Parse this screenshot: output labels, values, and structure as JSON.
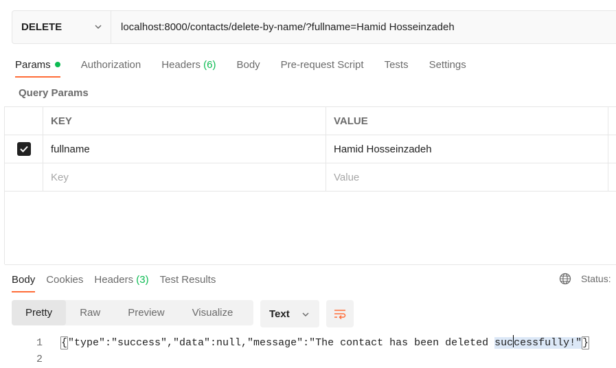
{
  "request": {
    "method": "DELETE",
    "url": "localhost:8000/contacts/delete-by-name/?fullname=Hamid Hosseinzadeh"
  },
  "request_tabs": [
    {
      "label": "Params"
    },
    {
      "label": "Authorization"
    },
    {
      "label": "Headers",
      "count": "(6)"
    },
    {
      "label": "Body"
    },
    {
      "label": "Pre-request Script"
    },
    {
      "label": "Tests"
    },
    {
      "label": "Settings"
    }
  ],
  "query_params": {
    "title": "Query Params",
    "headers": {
      "key": "KEY",
      "value": "VALUE"
    },
    "rows": [
      {
        "key": "fullname",
        "value": "Hamid Hosseinzadeh",
        "checked": true
      }
    ],
    "placeholder_key": "Key",
    "placeholder_value": "Value"
  },
  "response_tabs": [
    {
      "label": "Body"
    },
    {
      "label": "Cookies"
    },
    {
      "label": "Headers",
      "count": "(3)"
    },
    {
      "label": "Test Results"
    }
  ],
  "status_label": "Status:",
  "view_modes": [
    "Pretty",
    "Raw",
    "Preview",
    "Visualize"
  ],
  "format": "Text",
  "code": {
    "line_numbers": [
      "1",
      "2"
    ],
    "before_sel": "\"type\":\"success\",\"data\":null,\"message\":\"The contact has been deleted ",
    "sel_part1": "suc",
    "sel_part2": "cessfully!\"",
    "open_brace": "{",
    "close_brace": "}"
  },
  "colors": {
    "accent": "#ff6c37",
    "success": "#0cbb52"
  }
}
